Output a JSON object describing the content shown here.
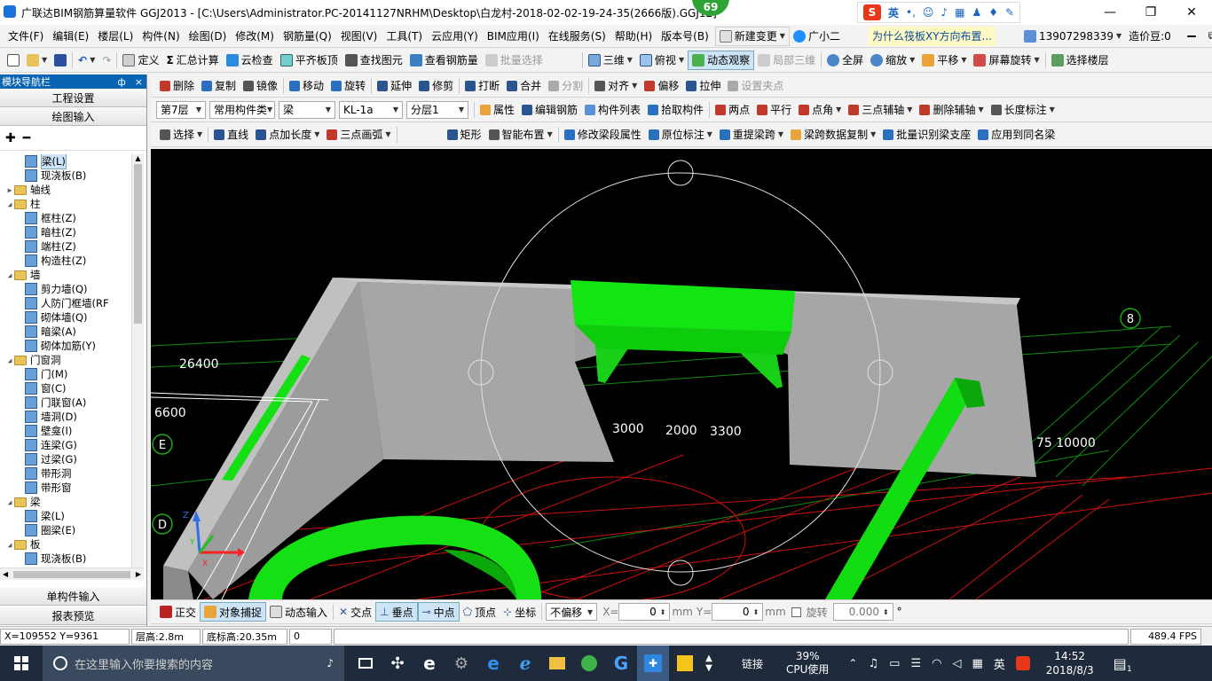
{
  "titlebar": {
    "title": "广联达BIM钢筋算量软件 GGJ2013 - [C:\\Users\\Administrator.PC-20141127NRHM\\Desktop\\白龙村-2018-02-02-19-24-35(2666版).GGJ12]",
    "badge": "69",
    "ime_label": "英",
    "ime_logo": "S"
  },
  "menubar": {
    "items": [
      "文件(F)",
      "编辑(E)",
      "楼层(L)",
      "构件(N)",
      "绘图(D)",
      "修改(M)",
      "钢筋量(Q)",
      "视图(V)",
      "工具(T)",
      "云应用(Y)",
      "BIM应用(I)",
      "在线服务(S)",
      "帮助(H)",
      "版本号(B)"
    ],
    "new_change": "新建变更",
    "assistant": "广小二",
    "question": "为什么筏板XY方向布置...",
    "phone": "13907298339",
    "beans": "造价豆:0"
  },
  "toolbar1": {
    "items": [
      "定义",
      "汇总计算",
      "云检查",
      "平齐板顶",
      "查找图元",
      "查看钢筋量",
      "批量选择"
    ],
    "view3d": "三维",
    "top_view": "俯视",
    "dynamic": "动态观察",
    "local3d": "局部三维",
    "fullscreen": "全屏",
    "zoom": "缩放",
    "pan": "平移",
    "rotate_screen": "屏幕旋转",
    "select_floor": "选择楼层"
  },
  "nav": {
    "title": "模块导航栏",
    "pin": "ф",
    "close": "×",
    "project_settings": "工程设置",
    "draw_input": "绘图输入",
    "single_input": "单构件输入",
    "report_preview": "报表预览",
    "tree": [
      {
        "level": 2,
        "type": "leaf",
        "label": "梁(L)",
        "selected": true
      },
      {
        "level": 2,
        "type": "leaf",
        "label": "现浇板(B)"
      },
      {
        "level": 1,
        "type": "folder",
        "label": "轴线",
        "exp": "▶"
      },
      {
        "level": 1,
        "type": "folder",
        "label": "柱",
        "exp": "◢"
      },
      {
        "level": 2,
        "type": "leaf",
        "label": "框柱(Z)"
      },
      {
        "level": 2,
        "type": "leaf",
        "label": "暗柱(Z)"
      },
      {
        "level": 2,
        "type": "leaf",
        "label": "端柱(Z)"
      },
      {
        "level": 2,
        "type": "leaf",
        "label": "构造柱(Z)"
      },
      {
        "level": 1,
        "type": "folder",
        "label": "墙",
        "exp": "◢"
      },
      {
        "level": 2,
        "type": "leaf",
        "label": "剪力墙(Q)"
      },
      {
        "level": 2,
        "type": "leaf",
        "label": "人防门框墙(RF"
      },
      {
        "level": 2,
        "type": "leaf",
        "label": "砌体墙(Q)"
      },
      {
        "level": 2,
        "type": "leaf",
        "label": "暗梁(A)"
      },
      {
        "level": 2,
        "type": "leaf",
        "label": "砌体加筋(Y)"
      },
      {
        "level": 1,
        "type": "folder",
        "label": "门窗洞",
        "exp": "◢"
      },
      {
        "level": 2,
        "type": "leaf",
        "label": "门(M)"
      },
      {
        "level": 2,
        "type": "leaf",
        "label": "窗(C)"
      },
      {
        "level": 2,
        "type": "leaf",
        "label": "门联窗(A)"
      },
      {
        "level": 2,
        "type": "leaf",
        "label": "墙洞(D)"
      },
      {
        "level": 2,
        "type": "leaf",
        "label": "壁龛(I)"
      },
      {
        "level": 2,
        "type": "leaf",
        "label": "连梁(G)"
      },
      {
        "level": 2,
        "type": "leaf",
        "label": "过梁(G)"
      },
      {
        "level": 2,
        "type": "leaf",
        "label": "带形洞"
      },
      {
        "level": 2,
        "type": "leaf",
        "label": "带形窗"
      },
      {
        "level": 1,
        "type": "folder",
        "label": "梁",
        "exp": "◢"
      },
      {
        "level": 2,
        "type": "leaf",
        "label": "梁(L)"
      },
      {
        "level": 2,
        "type": "leaf",
        "label": "圈梁(E)"
      },
      {
        "level": 1,
        "type": "folder",
        "label": "板",
        "exp": "◢"
      },
      {
        "level": 2,
        "type": "leaf",
        "label": "现浇板(B)"
      }
    ]
  },
  "toolbar2": {
    "items": [
      "删除",
      "复制",
      "镜像",
      "移动",
      "旋转",
      "延伸",
      "修剪",
      "打断",
      "合并",
      "分割",
      "对齐",
      "偏移",
      "拉伸",
      "设置夹点"
    ]
  },
  "toolbar3": {
    "floor": "第7层",
    "component_type": "常用构件类",
    "category": "梁",
    "component": "KL-1a",
    "layer": "分层1",
    "items": [
      "属性",
      "编辑钢筋",
      "构件列表",
      "拾取构件",
      "两点",
      "平行",
      "点角",
      "三点辅轴",
      "删除辅轴",
      "长度标注"
    ]
  },
  "toolbar4": {
    "items": [
      "选择",
      "直线",
      "点加长度",
      "三点画弧",
      "矩形",
      "智能布置",
      "修改梁段属性",
      "原位标注",
      "重提梁跨",
      "梁跨数据复制",
      "批量识别梁支座",
      "应用到同名梁"
    ]
  },
  "viewport": {
    "labels": [
      "26400",
      "6600",
      "3000",
      "2000",
      "3300",
      "75 10000"
    ],
    "axis_circles": [
      "E",
      "D",
      "8"
    ]
  },
  "snapbar": {
    "ortho": "正交",
    "snap": "对象捕捉",
    "dynamic_input": "动态输入",
    "intersection": "交点",
    "perpendicular": "垂点",
    "midpoint": "中点",
    "vertex": "顶点",
    "coordinate": "坐标",
    "offset": "不偏移",
    "x_label": "X=",
    "x_value": "0",
    "y_label": "Y=",
    "y_value": "0",
    "unit": "mm",
    "rotate_label": "旋转",
    "rotate_value": "0.000",
    "degree": "°"
  },
  "status": {
    "coords": "X=109552  Y=9361",
    "floor_height": "层高:2.8m",
    "bottom_height": "底标高:20.35m",
    "value": "0",
    "fps": "489.4 FPS"
  },
  "taskbar": {
    "search_placeholder": "在这里输入你要搜索的内容",
    "link_label": "链接",
    "cpu_percent": "39%",
    "cpu_label": "CPU使用",
    "lang": "英",
    "time": "14:52",
    "date": "2018/8/3",
    "notif": "1"
  },
  "colors": {
    "accent": "#0a64b4",
    "green": "#00ff00",
    "wall": "#a8a8a8"
  }
}
